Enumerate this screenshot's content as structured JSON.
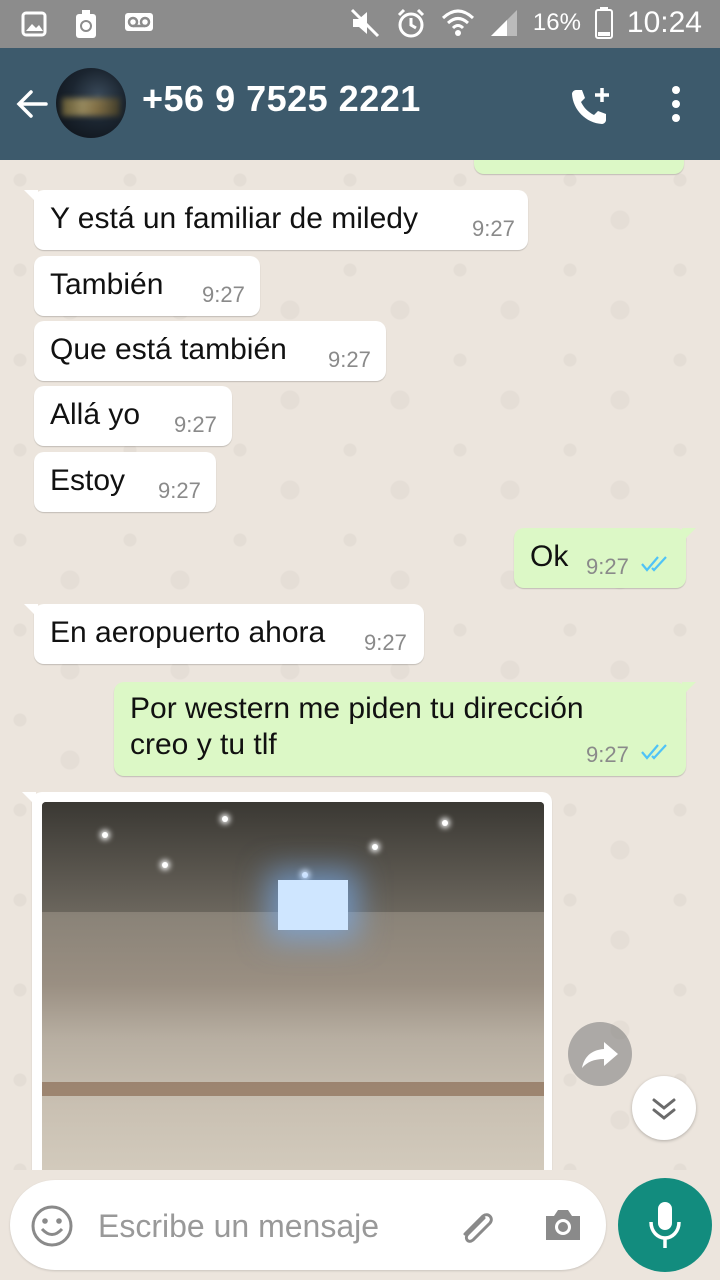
{
  "status_bar": {
    "battery_percent": "16%",
    "time": "10:24",
    "icons": [
      "image-icon",
      "battery-saver-icon",
      "voicemail-icon",
      "mute-icon",
      "alarm-icon",
      "wifi-icon",
      "signal-icon",
      "battery-icon"
    ]
  },
  "header": {
    "contact": "+56 9 7525 2221",
    "icons": [
      "back-arrow-icon",
      "add-call-icon",
      "more-vert-icon"
    ]
  },
  "messages": [
    {
      "dir": "in",
      "text": "Y está un familiar de miledy",
      "time": "9:27"
    },
    {
      "dir": "in",
      "text": "También",
      "time": "9:27"
    },
    {
      "dir": "in",
      "text": "Que está también",
      "time": "9:27"
    },
    {
      "dir": "in",
      "text": "Allá yo",
      "time": "9:27"
    },
    {
      "dir": "in",
      "text": "Estoy",
      "time": "9:27"
    },
    {
      "dir": "out",
      "text": "Ok",
      "time": "9:27",
      "status": "read"
    },
    {
      "dir": "in",
      "text": "En aeropuerto ahora",
      "time": "9:27"
    },
    {
      "dir": "out",
      "text_line1": "Por western me piden tu dirección",
      "text_line2": "creo y tu tlf",
      "time": "9:27",
      "status": "read"
    },
    {
      "dir": "in",
      "type": "image"
    }
  ],
  "composer": {
    "placeholder": "Escribe un mensaje",
    "icons": [
      "emoji-icon",
      "attach-icon",
      "camera-icon",
      "mic-icon"
    ]
  },
  "colors": {
    "header_bg": "#3d5a6c",
    "outgoing_bubble": "#dcf8c6",
    "incoming_bubble": "#ffffff",
    "read_ticks": "#4fc3f7",
    "mic_button": "#128c7e"
  }
}
